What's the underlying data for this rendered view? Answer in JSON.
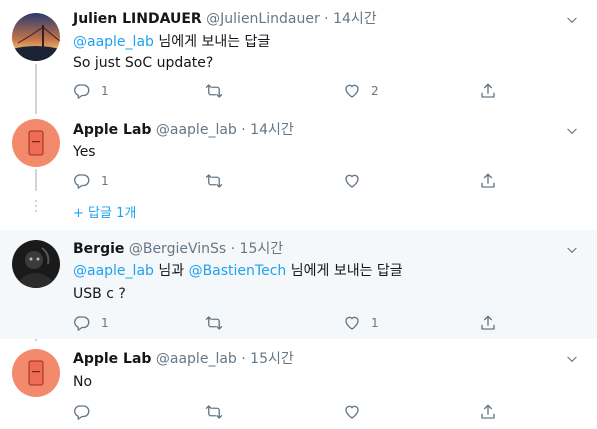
{
  "tweets": [
    {
      "name": "Julien LINDAUER",
      "handle": "@JulienLindauer",
      "dot": "·",
      "time": "14시간",
      "reply_to_mention": "@aaple_lab",
      "reply_to_suffix": " 님에게 보내는 답글",
      "text": "So just SoC update?",
      "reply_count": "1",
      "retweet_count": "",
      "like_count": "2"
    },
    {
      "name": "Apple Lab",
      "handle": "@aaple_lab",
      "dot": "·",
      "time": "14시간",
      "text": "Yes",
      "reply_count": "1",
      "retweet_count": "",
      "like_count": ""
    },
    {
      "name": "Bergie",
      "handle": "@BergieVinSs",
      "dot": "·",
      "time": "15시간",
      "reply_to_mention": "@aaple_lab",
      "reply_to_mid": " 님과 ",
      "reply_to_mention2": "@BastienTech",
      "reply_to_suffix": " 님에게 보내는 답글",
      "text": "USB c ?",
      "reply_count": "1",
      "retweet_count": "",
      "like_count": "1"
    },
    {
      "name": "Apple Lab",
      "handle": "@aaple_lab",
      "dot": "·",
      "time": "15시간",
      "text": "No",
      "reply_count": "",
      "retweet_count": "",
      "like_count": ""
    }
  ],
  "more_replies": "+ 답글 1개",
  "colors": {
    "link": "#1da1f2",
    "muted": "#657786",
    "line": "#ccd6dd",
    "highlight_bg": "#f5f8fa"
  }
}
